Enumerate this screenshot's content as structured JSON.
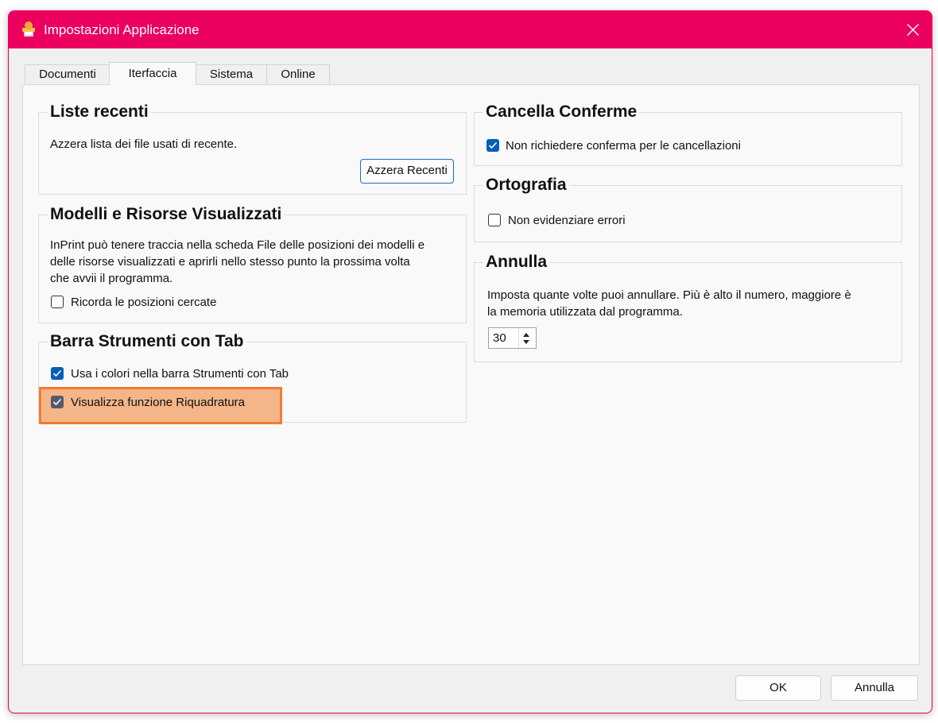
{
  "window": {
    "title": "Impostazioni Applicazione",
    "accent_color": "#eb0060",
    "app_icon": "inprint-app-icon",
    "close_icon": "close-icon"
  },
  "tabs": [
    {
      "label": "Documenti",
      "active": false
    },
    {
      "label": "Iterfaccia",
      "active": true
    },
    {
      "label": "Sistema",
      "active": false
    },
    {
      "label": "Online",
      "active": false
    }
  ],
  "liste_recenti": {
    "title": "Liste recenti",
    "description": "Azzera lista dei file usati di recente.",
    "button_label": "Azzera Recenti"
  },
  "modelli": {
    "title": "Modelli e Risorse Visualizzati",
    "description_lines": [
      "InPrint può tenere traccia nella scheda File delle posizioni dei modelli e",
      "delle risorse visualizzati  e aprirli nello stesso punto la prossima volta",
      "che avvii il programma."
    ],
    "checkbox_label": "Ricorda le posizioni cercate",
    "checkbox_checked": false
  },
  "barra_strumenti": {
    "title": "Barra Strumenti con Tab",
    "checkbox1_label": "Usa i colori nella barra Strumenti con Tab",
    "checkbox1_checked": true,
    "checkbox2_label": "Visualizza funzione Riquadratura",
    "checkbox2_checked": true,
    "checkbox2_highlighted": true,
    "highlight_color": "#f07d2c"
  },
  "cancella_conferme": {
    "title": "Cancella Conferme",
    "checkbox_label": "Non richiedere conferma per le cancellazioni",
    "checkbox_checked": true
  },
  "ortografia": {
    "title": "Ortografia",
    "checkbox_label": "Non evidenziare errori",
    "checkbox_checked": false
  },
  "annulla": {
    "title": "Annulla",
    "description_lines": [
      "Imposta quante volte puoi annullare. Più è alto il numero, maggiore è",
      "la memoria utilizzata dal programma."
    ],
    "spin_value": "30"
  },
  "footer": {
    "ok_label": "OK",
    "cancel_label": "Annulla"
  }
}
